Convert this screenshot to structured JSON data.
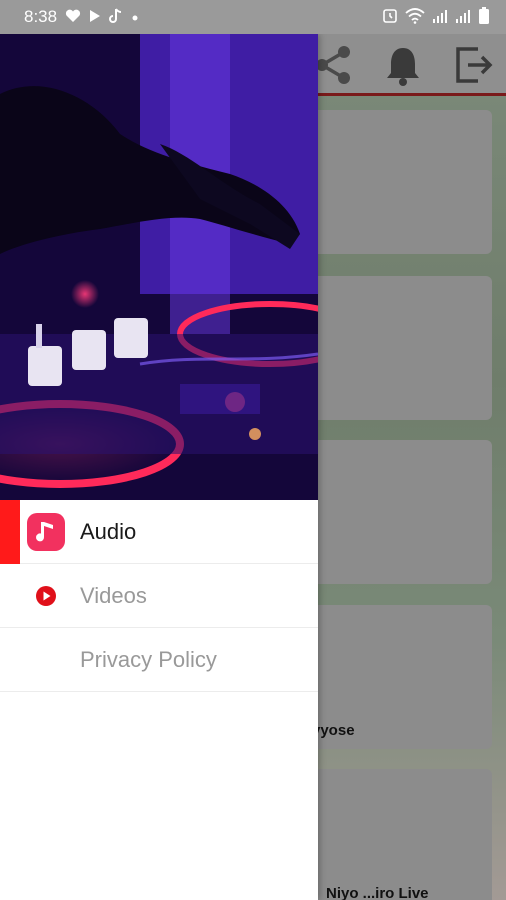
{
  "status_bar": {
    "time": "8:38",
    "left_icons": [
      "heart-icon",
      "play-icon",
      "tiktok-icon",
      "dot-icon"
    ],
    "right_icons": [
      "alarm-icon",
      "wifi-icon",
      "signal-icon",
      "signal-icon",
      "battery-icon"
    ]
  },
  "app_bar": {
    "icons": [
      "share-icon",
      "bell-icon",
      "exit-icon"
    ]
  },
  "background_cards": {
    "captions": [
      "vyose",
      "Niyo ...iro   Live"
    ]
  },
  "drawer": {
    "menu": [
      {
        "label": "Audio",
        "icon": "music-note-icon",
        "active": true
      },
      {
        "label": "Videos",
        "icon": "play-circle-icon",
        "active": false
      },
      {
        "label": "Privacy Policy",
        "icon": "",
        "active": false
      }
    ]
  },
  "colors": {
    "accent": "#ff1a1a",
    "audio_icon_bg": "#f2315f"
  }
}
